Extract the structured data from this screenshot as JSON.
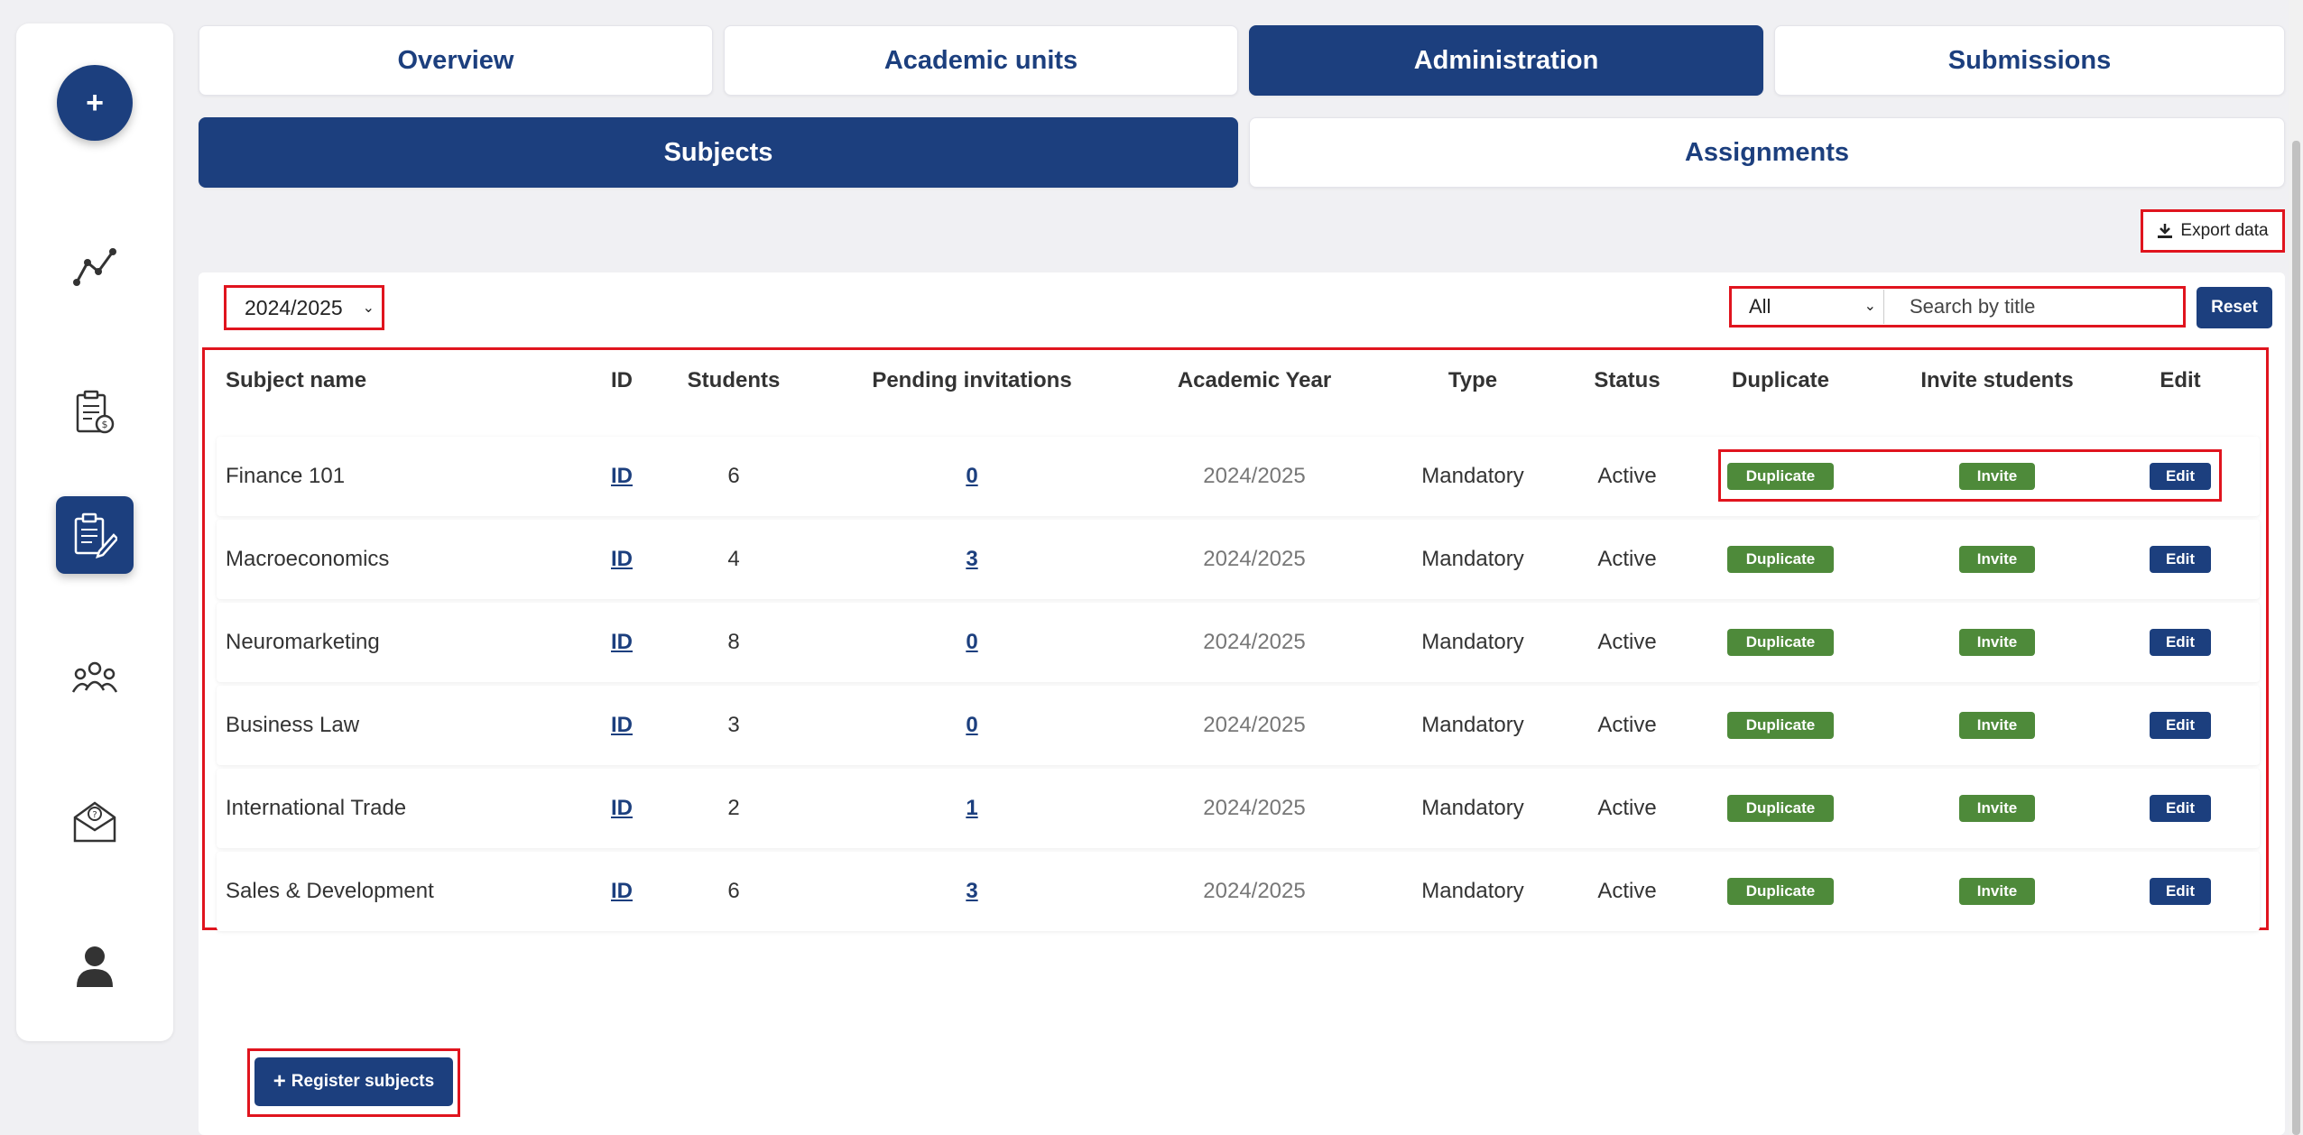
{
  "sidebar": {
    "add_label": "+",
    "icons": [
      "analytics-icon",
      "reports-icon",
      "assignments-icon",
      "users-icon",
      "help-mail-icon",
      "profile-icon"
    ]
  },
  "tabs": [
    {
      "label": "Overview",
      "active": false
    },
    {
      "label": "Academic units",
      "active": false
    },
    {
      "label": "Administration",
      "active": true
    },
    {
      "label": "Submissions",
      "active": false
    }
  ],
  "subtabs": [
    {
      "label": "Subjects",
      "active": true
    },
    {
      "label": "Assignments",
      "active": false
    }
  ],
  "toolbar": {
    "export_label": "Export data",
    "year_filter": "2024/2025",
    "type_filter": "All",
    "search_placeholder": "Search by title",
    "reset_label": "Reset"
  },
  "table": {
    "headers": [
      "Subject name",
      "ID",
      "Students",
      "Pending invitations",
      "Academic Year",
      "Type",
      "Status",
      "Duplicate",
      "Invite students",
      "Edit"
    ],
    "rows": [
      {
        "name": "Finance 101",
        "id": "ID",
        "students": "6",
        "pending": "0",
        "year": "2024/2025",
        "type": "Mandatory",
        "status": "Active",
        "duplicate": "Duplicate",
        "invite": "Invite",
        "edit": "Edit"
      },
      {
        "name": "Macroeconomics",
        "id": "ID",
        "students": "4",
        "pending": "3",
        "year": "2024/2025",
        "type": "Mandatory",
        "status": "Active",
        "duplicate": "Duplicate",
        "invite": "Invite",
        "edit": "Edit"
      },
      {
        "name": "Neuromarketing",
        "id": "ID",
        "students": "8",
        "pending": "0",
        "year": "2024/2025",
        "type": "Mandatory",
        "status": "Active",
        "duplicate": "Duplicate",
        "invite": "Invite",
        "edit": "Edit"
      },
      {
        "name": "Business Law",
        "id": "ID",
        "students": "3",
        "pending": "0",
        "year": "2024/2025",
        "type": "Mandatory",
        "status": "Active",
        "duplicate": "Duplicate",
        "invite": "Invite",
        "edit": "Edit"
      },
      {
        "name": "International Trade",
        "id": "ID",
        "students": "2",
        "pending": "1",
        "year": "2024/2025",
        "type": "Mandatory",
        "status": "Active",
        "duplicate": "Duplicate",
        "invite": "Invite",
        "edit": "Edit"
      },
      {
        "name": "Sales & Development",
        "id": "ID",
        "students": "6",
        "pending": "3",
        "year": "2024/2025",
        "type": "Mandatory",
        "status": "Active",
        "duplicate": "Duplicate",
        "invite": "Invite",
        "edit": "Edit"
      }
    ]
  },
  "footer": {
    "register_label": "Register subjects"
  },
  "colors": {
    "primary": "#1c3f7e",
    "success": "#4e8a3a",
    "highlight": "#e0141e"
  }
}
